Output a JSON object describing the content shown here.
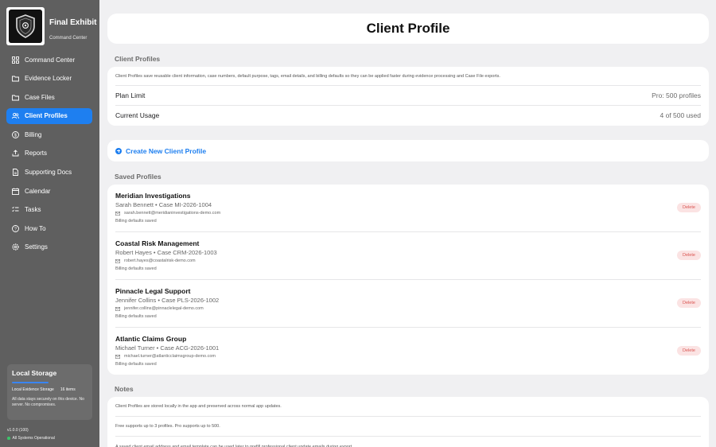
{
  "app": {
    "title": "Final Exhibit",
    "subtitle": "Command Center",
    "logo_text": "FINAL EXHIBIT"
  },
  "sidebar": {
    "items": [
      {
        "label": "Command Center",
        "icon": "grid-icon"
      },
      {
        "label": "Evidence Locker",
        "icon": "folder-icon"
      },
      {
        "label": "Case Files",
        "icon": "folder-icon"
      },
      {
        "label": "Client Profiles",
        "icon": "users-icon",
        "active": true
      },
      {
        "label": "Billing",
        "icon": "dollar-circle-icon"
      },
      {
        "label": "Reports",
        "icon": "upload-icon"
      },
      {
        "label": "Supporting Docs",
        "icon": "document-icon"
      },
      {
        "label": "Calendar",
        "icon": "calendar-icon"
      },
      {
        "label": "Tasks",
        "icon": "checklist-icon"
      },
      {
        "label": "How To",
        "icon": "help-circle-icon"
      },
      {
        "label": "Settings",
        "icon": "gear-icon"
      }
    ],
    "storage": {
      "title": "Local Storage",
      "label": "Local Evidence Storage",
      "count": "16 items",
      "note": "All data stays securely on this device. No server. No compromises."
    },
    "version": "v1.0.0 (100)",
    "status": "All Systems Operational"
  },
  "header": {
    "title": "Client Profile"
  },
  "client_profiles": {
    "section_label": "Client Profiles",
    "description": "Client Profiles save reusable client information, case numbers, default purpose, tags, email details, and billing defaults so they can be applied faster during evidence processing and Case File exports.",
    "plan_limit_label": "Plan Limit",
    "plan_limit_value": "Pro: 500 profiles",
    "usage_label": "Current Usage",
    "usage_value": "4 of 500 used"
  },
  "create": {
    "label": "Create New Client Profile"
  },
  "saved": {
    "section_label": "Saved Profiles",
    "delete_label": "Delete",
    "profiles": [
      {
        "name": "Meridian Investigations",
        "meta": "Sarah Bennett • Case MI-2026-1004",
        "email": "sarah.bennett@meridianinvestigations-demo.com",
        "billing": "Billing defaults saved"
      },
      {
        "name": "Coastal Risk Management",
        "meta": "Robert Hayes • Case CRM-2026-1003",
        "email": "robert.hayes@coastalrisk-demo.com",
        "billing": "Billing defaults saved"
      },
      {
        "name": "Pinnacle Legal Support",
        "meta": "Jennifer Collins • Case PLS-2026-1002",
        "email": "jennifer.collins@pinnaclelegal-demo.com",
        "billing": "Billing defaults saved"
      },
      {
        "name": "Atlantic Claims Group",
        "meta": "Michael Turner • Case ACG-2026-1001",
        "email": "michael.turner@atlanticclaimsgroup-demo.com",
        "billing": "Billing defaults saved"
      }
    ]
  },
  "notes": {
    "section_label": "Notes",
    "items": [
      "Client Profiles are stored locally in the app and preserved across normal app updates.",
      "Free supports up to 3 profiles. Pro supports up to 500.",
      "A saved client email address and email template can be used later to prefill professional client update emails during export."
    ]
  },
  "colors": {
    "accent": "#1e7ff0",
    "sidebar": "#5f5f5f",
    "danger": "#d9534f",
    "danger_bg": "#fbe3e3",
    "status_ok": "#3cc36a"
  }
}
